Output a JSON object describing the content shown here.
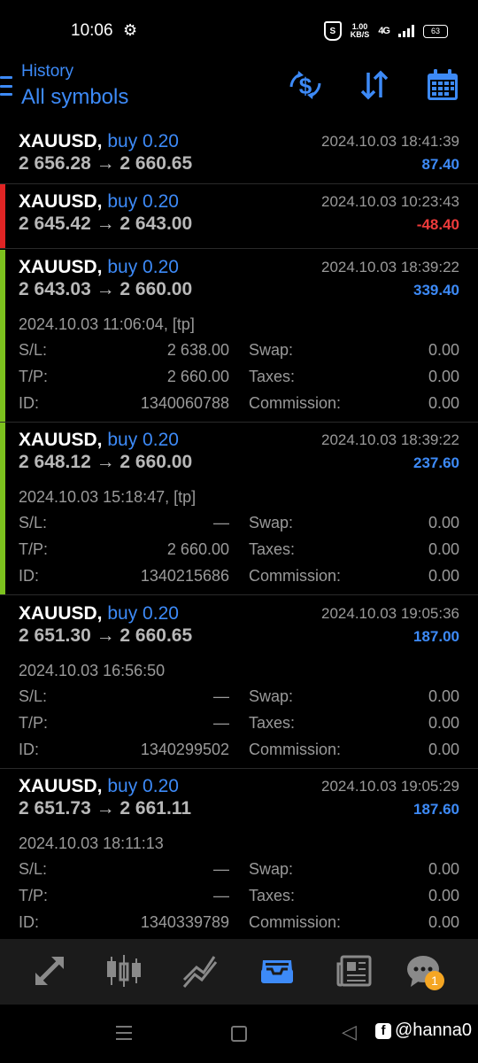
{
  "status_bar": {
    "time": "10:06",
    "net_speed_top": "1.00",
    "net_speed_bottom": "KB/S",
    "signal_label": "4G",
    "battery": "63"
  },
  "header": {
    "subtitle": "History",
    "title": "All symbols",
    "accent_color": "#3d8af7"
  },
  "deals": [
    {
      "symbol": "XAUUSD,",
      "type": "buy 0.20",
      "time": "2024.10.03 18:41:39",
      "prices": "2 656.28 → 2 660.65",
      "profit": "87.40",
      "profit_color": "#3d8af7",
      "stripe": "",
      "expanded": false
    },
    {
      "symbol": "XAUUSD,",
      "type": "buy 0.20",
      "time": "2024.10.03 10:23:43",
      "prices": "2 645.42 → 2 643.00",
      "profit": "-48.40",
      "profit_color": "#ee3b3b",
      "stripe": "#e02424",
      "expanded": false
    },
    {
      "symbol": "XAUUSD,",
      "type": "buy 0.20",
      "time": "2024.10.03 18:39:22",
      "prices": "2 643.03 → 2 660.00",
      "profit": "339.40",
      "profit_color": "#3d8af7",
      "stripe": "#7cc11e",
      "expanded": true,
      "open_time": "2024.10.03 11:06:04, [tp]",
      "sl": "2 638.00",
      "tp": "2 660.00",
      "id": "1340060788",
      "swap": "0.00",
      "taxes": "0.00",
      "commission": "0.00"
    },
    {
      "symbol": "XAUUSD,",
      "type": "buy 0.20",
      "time": "2024.10.03 18:39:22",
      "prices": "2 648.12 → 2 660.00",
      "profit": "237.60",
      "profit_color": "#3d8af7",
      "stripe": "#7cc11e",
      "expanded": true,
      "open_time": "2024.10.03 15:18:47, [tp]",
      "sl": "—",
      "tp": "2 660.00",
      "id": "1340215686",
      "swap": "0.00",
      "taxes": "0.00",
      "commission": "0.00"
    },
    {
      "symbol": "XAUUSD,",
      "type": "buy 0.20",
      "time": "2024.10.03 19:05:36",
      "prices": "2 651.30 → 2 660.65",
      "profit": "187.00",
      "profit_color": "#3d8af7",
      "stripe": "",
      "expanded": true,
      "open_time": "2024.10.03 16:56:50",
      "sl": "—",
      "tp": "—",
      "id": "1340299502",
      "swap": "0.00",
      "taxes": "0.00",
      "commission": "0.00"
    },
    {
      "symbol": "XAUUSD,",
      "type": "buy 0.20",
      "time": "2024.10.03 19:05:29",
      "prices": "2 651.73 → 2 661.11",
      "profit": "187.60",
      "profit_color": "#3d8af7",
      "stripe": "",
      "expanded": true,
      "open_time": "2024.10.03 18:11:13",
      "sl": "—",
      "tp": "—",
      "id": "1340339789",
      "swap": "0.00",
      "taxes": "0.00",
      "commission": "0.00"
    }
  ],
  "labels": {
    "sl": "S/L:",
    "tp": "T/P:",
    "id": "ID:",
    "swap": "Swap:",
    "taxes": "Taxes:",
    "commission": "Commission:"
  },
  "tabs": [
    {
      "name": "trade-arrows-icon"
    },
    {
      "name": "candlestick-chart-icon"
    },
    {
      "name": "trend-chart-icon"
    },
    {
      "name": "history-inbox-icon",
      "active": true
    },
    {
      "name": "news-icon"
    },
    {
      "name": "chat-icon"
    }
  ],
  "chat_badge": "1",
  "watermark": "@hanna0"
}
